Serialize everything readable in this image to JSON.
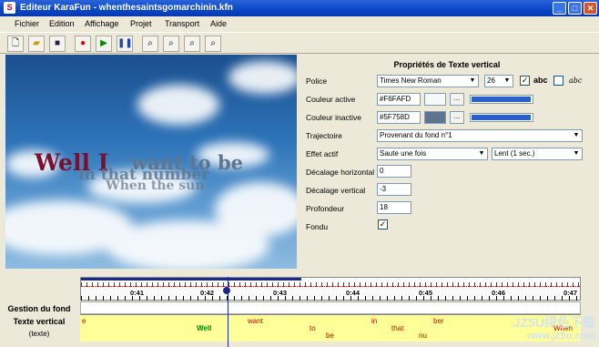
{
  "window": {
    "title": "Editeur KaraFun - whenthesaintsgomarchinin.kfn",
    "app_icon": "S"
  },
  "menu": [
    "Fichier",
    "Edition",
    "Affichage",
    "Projet",
    "Transport",
    "Aide"
  ],
  "preview": {
    "lyric_line1_a": "Well I",
    "lyric_line1_b": "want to be",
    "lyric_line2": "in that number",
    "lyric_line3": "When the sun"
  },
  "props": {
    "title": "Propriétés de Texte vertical",
    "police_label": "Police",
    "font_value": "Times New Roman",
    "size_value": "26",
    "abc_bold": "abc",
    "abc_italic": "abc",
    "couleur_active_label": "Couleur active",
    "couleur_active_value": "#F6FAFD",
    "couleur_inactive_label": "Couleur inactive",
    "couleur_inactive_value": "#5F758D",
    "browse": "...",
    "trajectoire_label": "Trajectoire",
    "trajectoire_value": "Provenant du fond n°1",
    "effet_label": "Effet actif",
    "effet_value": "Saute une fois",
    "effet_speed": "Lent (1 sec.)",
    "dec_h_label": "Décalage horizontal",
    "dec_h_value": "0",
    "dec_v_label": "Décalage vertical",
    "dec_v_value": "-3",
    "profondeur_label": "Profondeur",
    "profondeur_value": "18",
    "fondu_label": "Fondu",
    "check": "✓"
  },
  "timeline": {
    "track1": "Gestion du fond",
    "track2": "Texte vertical",
    "track3": "(texte)",
    "ticks": [
      "0:41",
      "0:42",
      "0:43",
      "0:44",
      "0:45",
      "0:46",
      "0:47"
    ],
    "words": [
      "e",
      "Well",
      "want",
      "to",
      "be",
      "in",
      "that",
      "nu",
      "ber",
      "When"
    ]
  },
  "colors": {
    "active": "#F6FAFD",
    "inactive": "#5F758D",
    "lyric_sung": "#7a1030"
  },
  "watermark": {
    "line1": "JZ5U绿色下载",
    "line2": "www.jz5u.com"
  }
}
